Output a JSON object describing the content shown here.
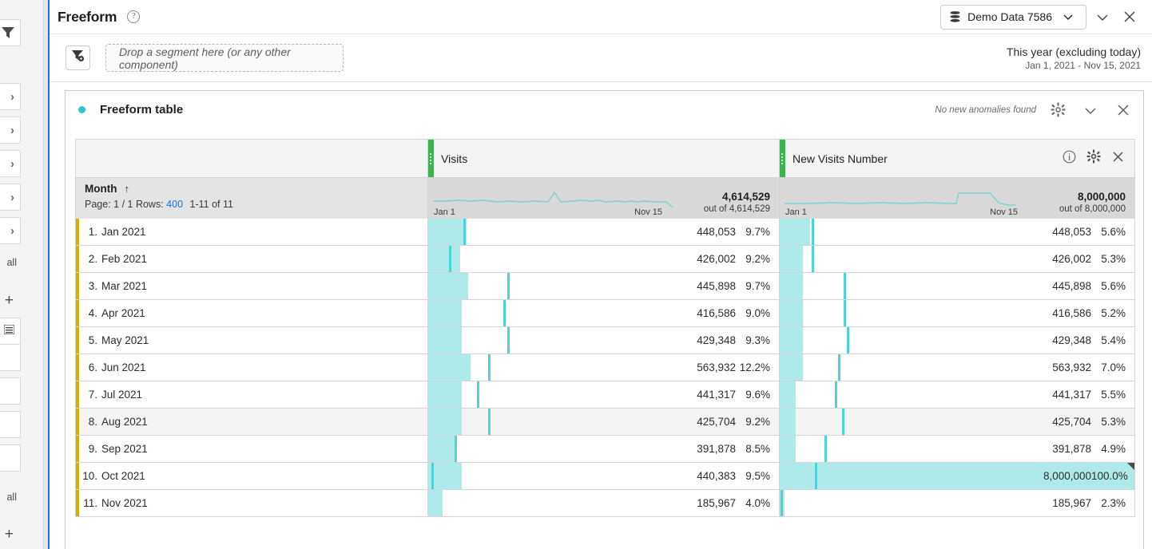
{
  "rail": {
    "filter_icon": "funnel-icon",
    "chevron_items": [
      "chevron-right-icon",
      "chevron-right-icon",
      "chevron-right-icon",
      "chevron-right-icon",
      "chevron-right-icon"
    ],
    "show_all_1": "all",
    "add_1": "+",
    "list_icon": "list-icon",
    "show_all_2": "all",
    "add_2": "+"
  },
  "header": {
    "title": "Freeform",
    "help_icon": "help-circle-icon",
    "project": {
      "icon": "database-icon",
      "label": "Demo Data 7586",
      "chevron": "chevron-down-icon"
    },
    "collapse_icon": "chevron-down-icon",
    "close_icon": "close-icon"
  },
  "segmentbar": {
    "filter_button_icon": "add-filter-icon",
    "dropzone_placeholder": "Drop a segment here (or any other component)",
    "date_range_label": "This year (excluding today)",
    "date_range_value": "Jan 1, 2021 - Nov 15, 2021"
  },
  "panel": {
    "status_dot": "status-dot",
    "title": "Freeform table",
    "anomaly_text": "No new anomalies found",
    "gear_icon": "gear-icon",
    "chevron_icon": "chevron-down-icon",
    "close_icon": "close-icon"
  },
  "table": {
    "dimension": {
      "name": "Month",
      "sort_arrow": "↑",
      "page_label": "Page: 1 / 1",
      "rows_label": "Rows:",
      "rows_value": "400",
      "range_label": "1-11 of 11"
    },
    "metrics": [
      {
        "name": "Visits",
        "info_icon": null,
        "gear_icon": "gear-icon",
        "close_icon": "close-icon",
        "spark_left": "Jan 1",
        "spark_right": "Nov 15",
        "total": "4,614,529",
        "total_sub": "out of 4,614,529"
      },
      {
        "name": "New Visits Number",
        "info_icon": "info-icon",
        "gear_icon": "gear-icon",
        "close_icon": "close-icon",
        "spark_left": "Jan 1",
        "spark_right": "Nov 15",
        "total": "8,000,000",
        "total_sub": "out of 8,000,000"
      }
    ],
    "rows": [
      {
        "rank": "1.",
        "label": "Jan 2021",
        "hover": false,
        "visits": {
          "value": "448,053",
          "pct": "9.7%",
          "fill": 11.0,
          "mark": 10.0,
          "corner": false
        },
        "newvisits": {
          "value": "448,053",
          "pct": "5.6%",
          "fill": 8.5,
          "mark": 9.0,
          "corner": false
        }
      },
      {
        "rank": "2.",
        "label": "Feb 2021",
        "hover": false,
        "visits": {
          "value": "426,002",
          "pct": "9.2%",
          "fill": 9.0,
          "mark": 6.0,
          "corner": false
        },
        "newvisits": {
          "value": "426,002",
          "pct": "5.3%",
          "fill": 6.5,
          "mark": 9.0,
          "corner": false
        }
      },
      {
        "rank": "3.",
        "label": "Mar 2021",
        "hover": false,
        "visits": {
          "value": "445,898",
          "pct": "9.7%",
          "fill": 11.5,
          "mark": 22.5,
          "corner": false
        },
        "newvisits": {
          "value": "445,898",
          "pct": "5.6%",
          "fill": 6.5,
          "mark": 18.0,
          "corner": false
        }
      },
      {
        "rank": "4.",
        "label": "Apr 2021",
        "hover": false,
        "visits": {
          "value": "416,586",
          "pct": "9.0%",
          "fill": 9.5,
          "mark": 21.5,
          "corner": false
        },
        "newvisits": {
          "value": "416,586",
          "pct": "5.2%",
          "fill": 6.5,
          "mark": 18.0,
          "corner": false
        }
      },
      {
        "rank": "5.",
        "label": "May 2021",
        "hover": false,
        "visits": {
          "value": "429,348",
          "pct": "9.3%",
          "fill": 9.5,
          "mark": 22.5,
          "corner": false
        },
        "newvisits": {
          "value": "429,348",
          "pct": "5.4%",
          "fill": 6.5,
          "mark": 19.0,
          "corner": false
        }
      },
      {
        "rank": "6.",
        "label": "Jun 2021",
        "hover": false,
        "visits": {
          "value": "563,932",
          "pct": "12.2%",
          "fill": 12.0,
          "mark": 17.0,
          "corner": false
        },
        "newvisits": {
          "value": "563,932",
          "pct": "7.0%",
          "fill": 6.5,
          "mark": 16.5,
          "corner": false
        }
      },
      {
        "rank": "7.",
        "label": "Jul 2021",
        "hover": false,
        "visits": {
          "value": "441,317",
          "pct": "9.6%",
          "fill": 9.5,
          "mark": 14.0,
          "corner": false
        },
        "newvisits": {
          "value": "441,317",
          "pct": "5.5%",
          "fill": 4.5,
          "mark": 15.5,
          "corner": false
        }
      },
      {
        "rank": "8.",
        "label": "Aug 2021",
        "hover": true,
        "visits": {
          "value": "425,704",
          "pct": "9.2%",
          "fill": 9.5,
          "mark": 17.0,
          "corner": false
        },
        "newvisits": {
          "value": "425,704",
          "pct": "5.3%",
          "fill": 4.5,
          "mark": 17.5,
          "corner": false
        }
      },
      {
        "rank": "9.",
        "label": "Sep 2021",
        "hover": false,
        "visits": {
          "value": "391,878",
          "pct": "8.5%",
          "fill": 8.0,
          "mark": 7.5,
          "corner": false
        },
        "newvisits": {
          "value": "391,878",
          "pct": "4.9%",
          "fill": 4.5,
          "mark": 12.5,
          "corner": false
        }
      },
      {
        "rank": "10.",
        "label": "Oct 2021",
        "hover": false,
        "visits": {
          "value": "440,383",
          "pct": "9.5%",
          "fill": 9.5,
          "mark": 1.0,
          "corner": false
        },
        "newvisits": {
          "value": "8,000,000",
          "pct": "100.0%",
          "fill": 100.0,
          "mark": 10.0,
          "corner": true
        }
      },
      {
        "rank": "11.",
        "label": "Nov 2021",
        "hover": false,
        "visits": {
          "value": "185,967",
          "pct": "4.0%",
          "fill": 4.0,
          "mark": null,
          "corner": false
        },
        "newvisits": {
          "value": "185,967",
          "pct": "2.3%",
          "fill": 1.3,
          "mark": 0.3,
          "corner": false
        }
      }
    ]
  },
  "colors": {
    "accent_teal": "#4fd3d6",
    "bar_fill": "#aeeae9",
    "metric_green": "#3fb24d",
    "dimension_gold": "#d9ae00",
    "link_blue": "#1473e6"
  },
  "chart_data": {
    "type": "table",
    "title": "Freeform table",
    "categories": [
      "Jan 2021",
      "Feb 2021",
      "Mar 2021",
      "Apr 2021",
      "May 2021",
      "Jun 2021",
      "Jul 2021",
      "Aug 2021",
      "Sep 2021",
      "Oct 2021",
      "Nov 2021"
    ],
    "series": [
      {
        "name": "Visits",
        "values": [
          448053,
          426002,
          445898,
          416586,
          429348,
          563932,
          441317,
          425704,
          391878,
          440383,
          185967
        ],
        "percents": [
          9.7,
          9.2,
          9.7,
          9.0,
          9.3,
          12.2,
          9.6,
          9.2,
          8.5,
          9.5,
          4.0
        ],
        "total": 4614529
      },
      {
        "name": "New Visits Number",
        "values": [
          448053,
          426002,
          445898,
          416586,
          429348,
          563932,
          441317,
          425704,
          391878,
          8000000,
          185967
        ],
        "percents": [
          5.6,
          5.3,
          5.6,
          5.2,
          5.4,
          7.0,
          5.5,
          5.3,
          4.9,
          100.0,
          2.3
        ],
        "total": 8000000
      }
    ],
    "xlabel": "Month",
    "ylabel": "",
    "grid": false,
    "legend": "none"
  }
}
